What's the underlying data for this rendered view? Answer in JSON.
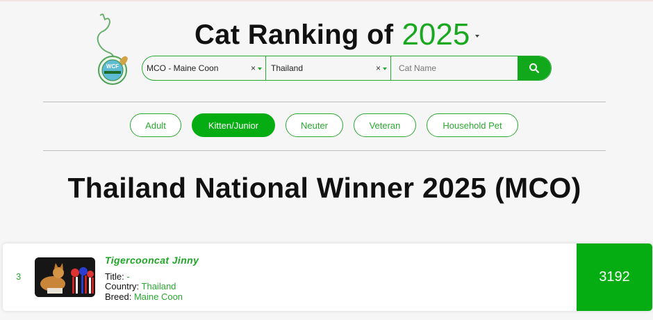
{
  "header": {
    "title": "Cat Ranking of",
    "year": "2025",
    "logo_text": "WCF"
  },
  "search": {
    "breed_value": "MCO - Maine Coon",
    "country_value": "Thailand",
    "catname_placeholder": "Cat Name",
    "clear_glyph": "×"
  },
  "categories": [
    {
      "label": "Adult",
      "active": false
    },
    {
      "label": "Kitten/Junior",
      "active": true
    },
    {
      "label": "Neuter",
      "active": false
    },
    {
      "label": "Veteran",
      "active": false
    },
    {
      "label": "Household Pet",
      "active": false
    }
  ],
  "main": {
    "heading": "Thailand National Winner 2025 (MCO)"
  },
  "result": {
    "rank": "3",
    "name": "Tigercooncat Jinny",
    "title_label": "Title:",
    "title_value": "-",
    "country_label": "Country:",
    "country_value": "Thailand",
    "breed_label": "Breed:",
    "breed_value": "Maine Coon",
    "score": "3192"
  },
  "colors": {
    "accent": "#05ad12",
    "accent_text": "#2aa830"
  },
  "icons": {
    "search": "search-icon",
    "logo": "wcf-logo-icon"
  }
}
